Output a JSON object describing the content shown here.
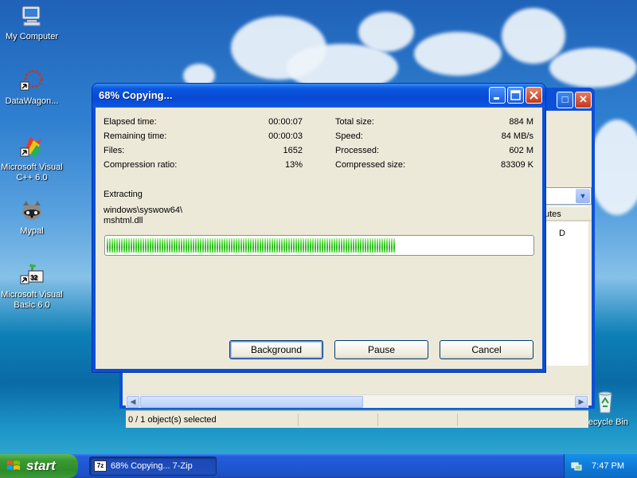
{
  "desktop": {
    "icons": [
      {
        "label": "My Computer",
        "icon": "my-computer-icon"
      },
      {
        "label": "DataWagon...",
        "icon": "datawagon-icon"
      },
      {
        "label": "Microsoft Visual C++ 6.0",
        "icon": "visual-cpp-icon"
      },
      {
        "label": "Mypal",
        "icon": "mypal-raccoon-icon"
      },
      {
        "label": "Microsoft Visual Basic 6.0",
        "icon": "visual-basic-icon"
      },
      {
        "label": "Recycle Bin",
        "icon": "recycle-bin-icon"
      }
    ]
  },
  "background_window": {
    "column_header": "utes",
    "cell_value": "D",
    "status": "0 / 1 object(s) selected",
    "title_buttons": {
      "maximize": "□",
      "close": "✕"
    }
  },
  "dialog": {
    "title": "68% Copying...",
    "stats_left": [
      {
        "label": "Elapsed time:",
        "value": "00:00:07"
      },
      {
        "label": "Remaining time:",
        "value": "00:00:03"
      },
      {
        "label": "Files:",
        "value": "1652"
      },
      {
        "label": "Compression ratio:",
        "value": "13%"
      }
    ],
    "stats_right": [
      {
        "label": "Total size:",
        "value": "884 M"
      },
      {
        "label": "Speed:",
        "value": "84 MB/s"
      },
      {
        "label": "Processed:",
        "value": "602 M"
      },
      {
        "label": "Compressed size:",
        "value": "83309 K"
      }
    ],
    "operation": "Extracting",
    "current_path": "windows\\syswow64\\",
    "current_file": "mshtml.dll",
    "progress_percent": 68,
    "buttons": {
      "background": "Background",
      "pause": "Pause",
      "cancel": "Cancel"
    }
  },
  "taskbar": {
    "start_label": "start",
    "task_label": "68% Copying... 7-Zip",
    "task_icon_text": "7z",
    "clock": "7:47 PM"
  },
  "colors": {
    "xp_blue": "#0a4fd6",
    "dialog_face": "#ece9d8",
    "progress_green": "#2bb31d",
    "start_green": "#3c9a34"
  }
}
